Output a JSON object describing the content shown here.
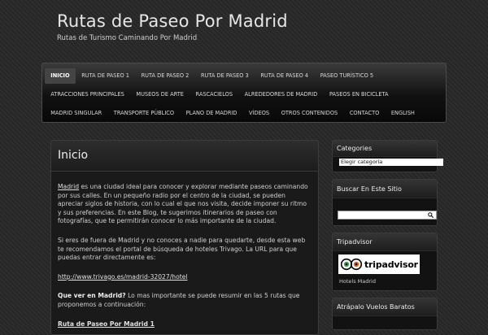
{
  "header": {
    "title": "Rutas de Paseo Por Madrid",
    "description": "Rutas de Turismo Caminando Por Madrid"
  },
  "nav": {
    "rows": [
      [
        "Inicio",
        "Ruta de Paseo 1",
        "Ruta de Paseo 2",
        "Ruta de Paseo 3",
        "Ruta de Paseo 4",
        "Paseo Turístico 5"
      ],
      [
        "Atracciones Principales",
        "Museos de Arte",
        "Rascacielos",
        "Alrededores de Madrid",
        "Paseos en Bicicleta"
      ],
      [
        "Madrid Singular",
        "Transporte Público",
        "Plano de Madrid",
        "Vídeos",
        "Otros Contenidos",
        "Contacto",
        "English"
      ]
    ],
    "active": "Inicio"
  },
  "content": {
    "title": "Inicio",
    "p1_link": "Madrid",
    "p1_text": " es una ciudad ideal para conocer y explorar mediante paseos caminando por sus calles. En un pequeño radio por el centro de la ciudad, se pueden apreciar siglos de historia, con lo cual el que nos visita, decide imponer su ritmo y sus preferencias.  En este Blog, te sugerimos itinerarios de paseo con fotografías, que te permitirán conocer lo más importante de la ciudad.",
    "p2": "Si eres de fuera de Madrid y no conoces a nadie para quedarte, desde esta web te recomendamos el portal de búsqueda de hoteles Trivago.  La URL para que puedas entrar directamente es:",
    "p3_link": "http://www.trivago.es/madrid-32027/hotel",
    "p4_bold": "Que ver en Madrid?",
    "p4_text": "  Lo mas importante se puede resumir en las 5 rutas que proponemos a continuación:",
    "p5_link": "Ruta de Paseo Por Madrid 1"
  },
  "sidebar": {
    "categories": {
      "title": "Categories",
      "select_value": "Elegir categoría"
    },
    "search": {
      "title": "Buscar En Este Sitio"
    },
    "tripadvisor": {
      "title": "Tripadvisor",
      "logo_text": "tripadvisor",
      "caption": "Hotels Madrid"
    },
    "vuelos": {
      "title": "Atrápalo Vuelos Baratos"
    }
  }
}
